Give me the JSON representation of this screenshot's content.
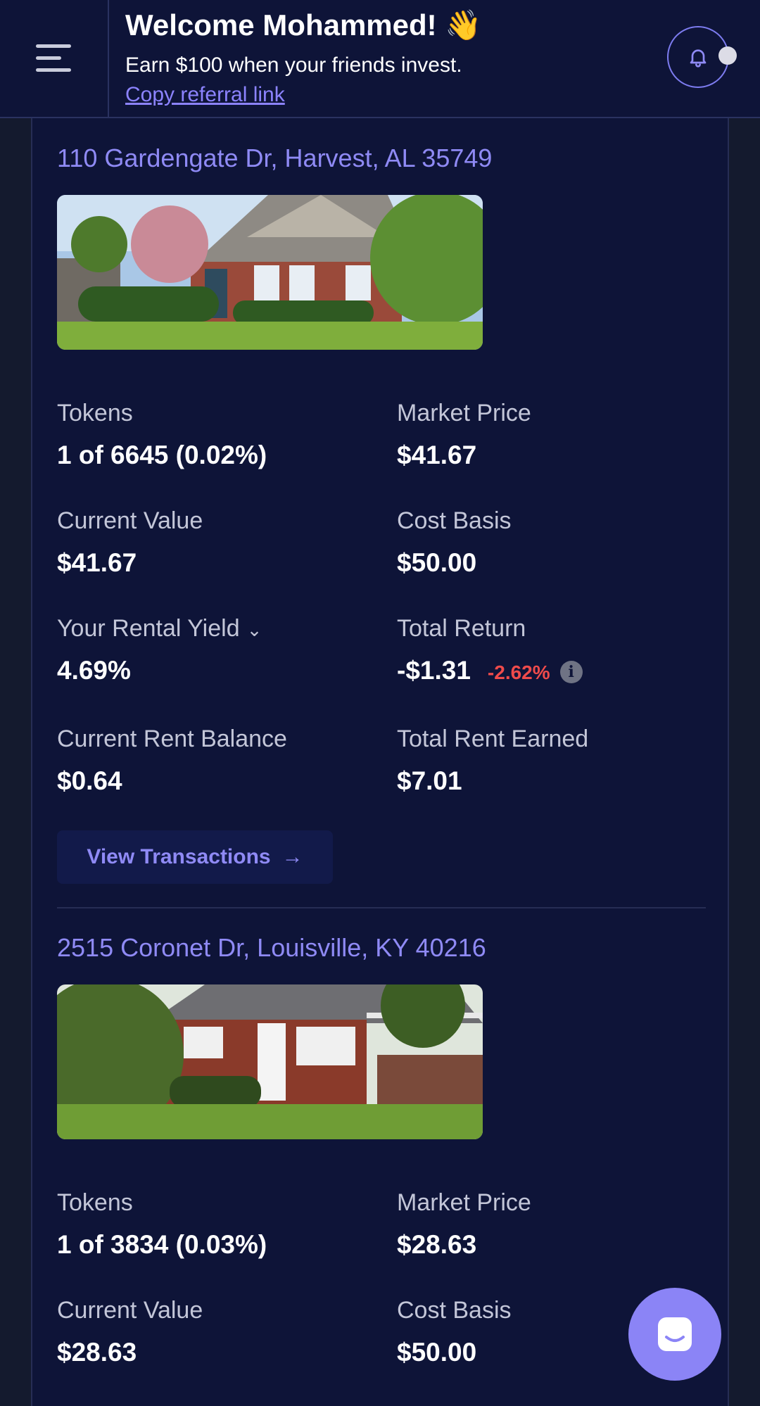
{
  "header": {
    "welcome": "Welcome Mohammed! 👋",
    "earn_text": "Earn $100 when your friends invest.",
    "referral_link": "Copy referral link"
  },
  "properties": [
    {
      "address": "110 Gardengate Dr, Harvest, AL 35749",
      "tokens_label": "Tokens",
      "tokens_value": "1 of 6645 (0.02%)",
      "market_price_label": "Market Price",
      "market_price_value": "$41.67",
      "current_value_label": "Current Value",
      "current_value_value": "$41.67",
      "cost_basis_label": "Cost Basis",
      "cost_basis_value": "$50.00",
      "rental_yield_label": "Your Rental Yield",
      "rental_yield_value": "4.69%",
      "total_return_label": "Total Return",
      "total_return_value": "-$1.31",
      "total_return_pct": "-2.62%",
      "rent_balance_label": "Current Rent Balance",
      "rent_balance_value": "$0.64",
      "rent_earned_label": "Total Rent Earned",
      "rent_earned_value": "$7.01",
      "view_transactions": "View Transactions"
    },
    {
      "address": "2515 Coronet Dr, Louisville, KY 40216",
      "tokens_label": "Tokens",
      "tokens_value": "1 of 3834 (0.03%)",
      "market_price_label": "Market Price",
      "market_price_value": "$28.63",
      "current_value_label": "Current Value",
      "current_value_value": "$28.63",
      "cost_basis_label": "Cost Basis",
      "cost_basis_value": "$50.00"
    }
  ],
  "colors": {
    "background": "#0e1438",
    "accent": "#8f8af5",
    "negative": "#ef4b4b"
  },
  "icons": [
    "menu-icon",
    "bell-icon",
    "info-icon",
    "chevron-down-icon",
    "arrow-right-icon",
    "chat-icon"
  ]
}
